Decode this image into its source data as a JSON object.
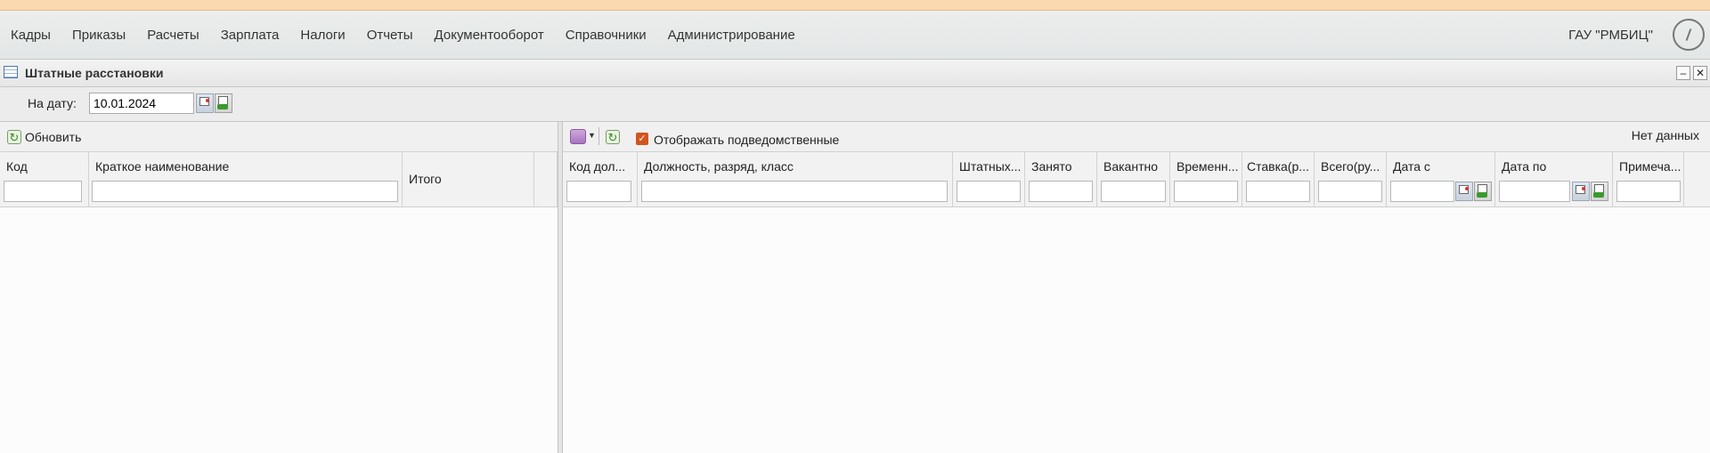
{
  "menu": {
    "items": [
      "Кадры",
      "Приказы",
      "Расчеты",
      "Зарплата",
      "Налоги",
      "Отчеты",
      "Документооборот",
      "Справочники",
      "Администрирование"
    ],
    "org": "ГАУ \"РМБИЦ\""
  },
  "panel": {
    "title": "Штатные расстановки"
  },
  "date_filter": {
    "label": "На дату:",
    "value": "10.01.2024"
  },
  "left_grid": {
    "refresh_label": "Обновить",
    "columns": [
      "Код",
      "Краткое наименование",
      "Итого"
    ]
  },
  "right_grid": {
    "show_subordinate_label": "Отображать подведомственные",
    "show_subordinate_checked": true,
    "no_data": "Нет данных",
    "columns": [
      "Код дол...",
      "Должность, разряд, класс",
      "Штатных...",
      "Занято",
      "Вакантно",
      "Временн...",
      "Ставка(р...",
      "Всего(ру...",
      "Дата с",
      "Дата по",
      "Примеча..."
    ]
  }
}
